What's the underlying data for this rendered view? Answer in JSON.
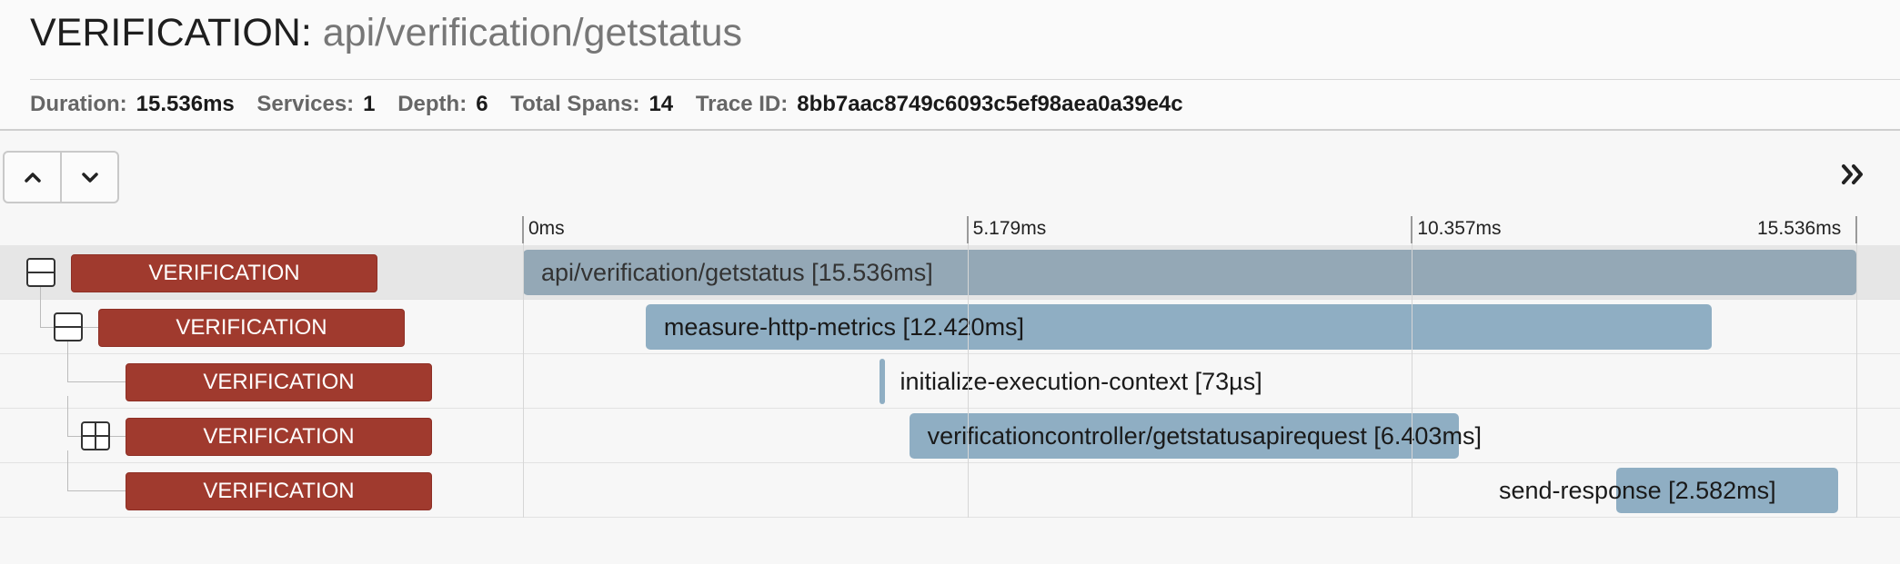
{
  "trace": {
    "service": "VERIFICATION",
    "separator": ":",
    "operation": "api/verification/getstatus",
    "stats": [
      {
        "key": "Duration:",
        "value": "15.536ms"
      },
      {
        "key": "Services:",
        "value": "1"
      },
      {
        "key": "Depth:",
        "value": "6"
      },
      {
        "key": "Total Spans:",
        "value": "14"
      },
      {
        "key": "Trace ID:",
        "value": "8bb7aac8749c6093c5ef98aea0a39e4c"
      }
    ]
  },
  "toolbar": {
    "up_icon": "chevron-up-icon",
    "down_icon": "chevron-down-icon",
    "expand_all_icon": "double-chevron-right-icon"
  },
  "ruler": {
    "ticks": [
      "0ms",
      "5.179ms",
      "10.357ms",
      "15.536ms"
    ]
  },
  "spans": [
    {
      "service": "VERIFICATION",
      "name": "api/verification/getstatus [15.536ms]",
      "start_ms": 0,
      "duration_ms": 15.536,
      "depth": 0,
      "toggle": "collapse",
      "selected": true
    },
    {
      "service": "VERIFICATION",
      "name": "measure-http-metrics [12.420ms]",
      "start_ms": 1.43,
      "duration_ms": 12.42,
      "depth": 1,
      "toggle": "collapse",
      "selected": false
    },
    {
      "service": "VERIFICATION",
      "name": "initialize-execution-context [73µs]",
      "start_ms": 4.15,
      "duration_ms": 0.073,
      "depth": 2,
      "toggle": "none",
      "selected": false
    },
    {
      "service": "VERIFICATION",
      "name": "verificationcontroller/getstatusapirequest [6.403ms]",
      "start_ms": 4.5,
      "duration_ms": 6.403,
      "depth": 2,
      "toggle": "expand",
      "selected": false
    },
    {
      "service": "VERIFICATION",
      "name": "send-response [2.582ms]",
      "start_ms": 12.74,
      "duration_ms": 2.582,
      "depth": 2,
      "toggle": "none",
      "selected": false
    }
  ],
  "colors": {
    "service_tag": "#a03a2e",
    "span_bar": "#8faec3",
    "root_bar": "#94a8b6"
  }
}
